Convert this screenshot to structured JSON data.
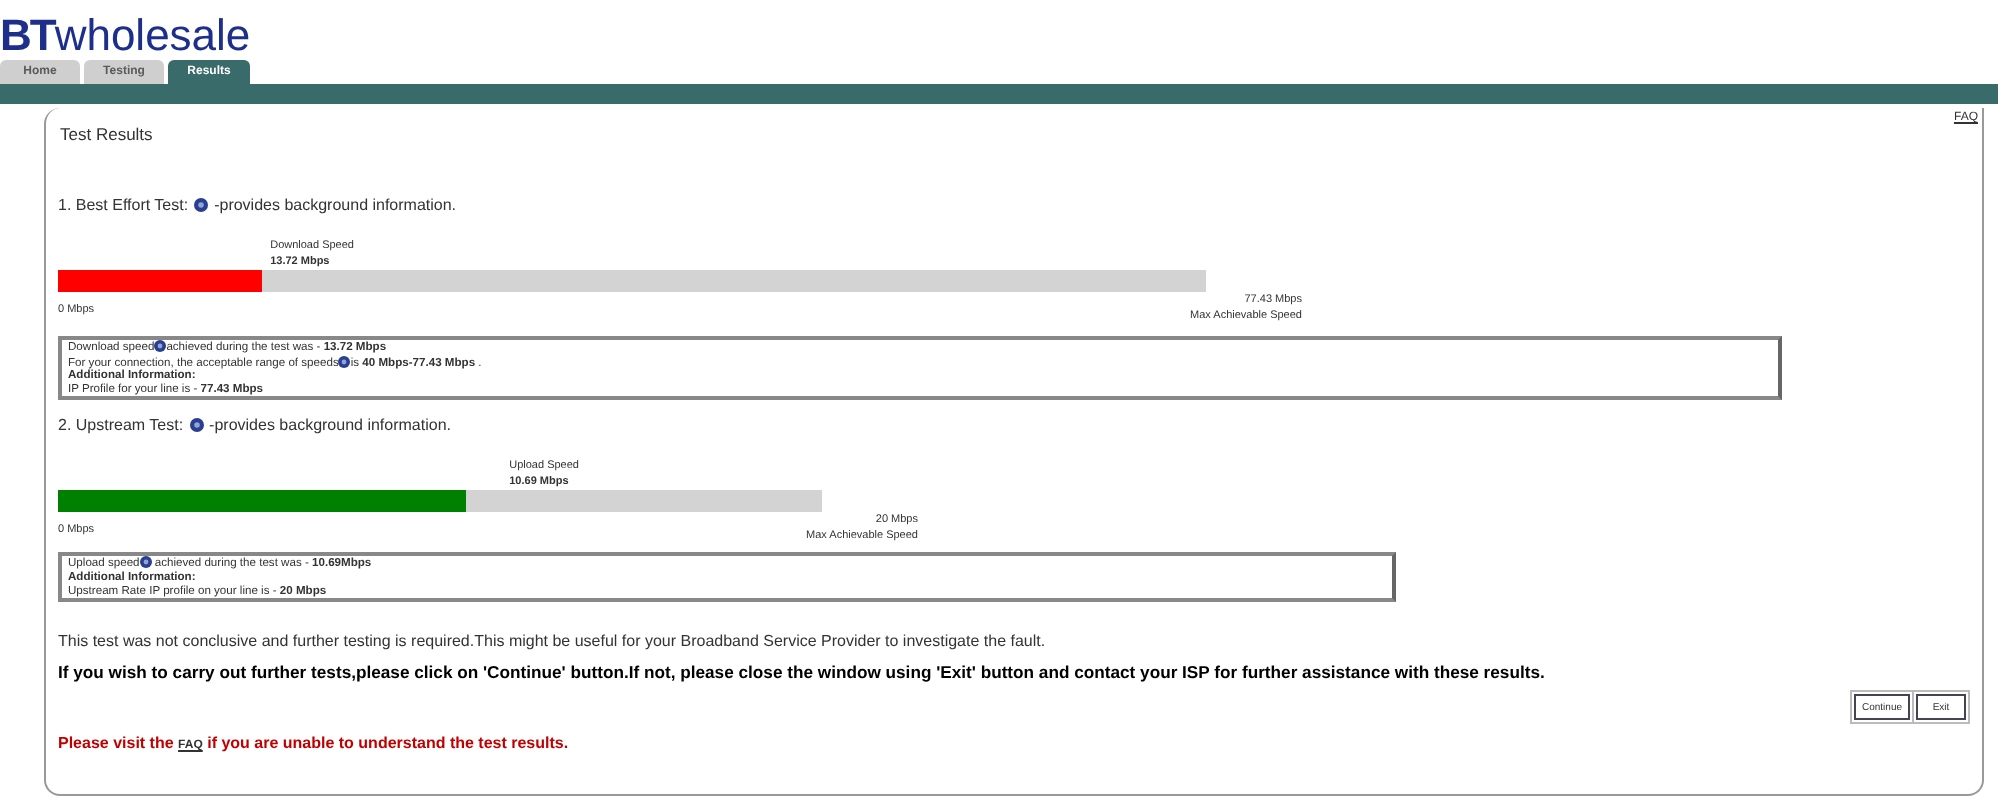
{
  "logo": {
    "brand": "BT",
    "name": "wholesale"
  },
  "tabs": [
    {
      "label": "Home",
      "selected": false
    },
    {
      "label": "Testing",
      "selected": false
    },
    {
      "label": "Results",
      "selected": true
    }
  ],
  "faq_link": "FAQ",
  "title": "Test Results",
  "tests": [
    {
      "heading": "1. Best Effort Test:",
      "note": "-provides background information.",
      "color": "#ff0000",
      "speed_label": "Download Speed",
      "speed": "13.72 Mbps",
      "level": 0.177,
      "min": "0 Mbps",
      "max": "77.43 Mbps",
      "max_label": "Max Achievable Speed",
      "info": [
        {
          "kind": "text",
          "text": "Download speed",
          "after": "achieved during the test was - **13.72 Mbps**"
        },
        {
          "kind": "text",
          "text": "For your connection, the acceptable range of speeds",
          "after": "is **40 Mbps-77.43 Mbps** ."
        },
        {
          "kind": "heading",
          "text": "Additional Information:"
        },
        {
          "kind": "text",
          "text": "IP Profile for your line is - **77.43 Mbps**"
        }
      ]
    },
    {
      "heading": "2. Upstream Test:",
      "note": "-provides background information.",
      "color": "#008000",
      "speed_label": "Upload Speed",
      "speed": "10.69 Mbps",
      "level": 0.534,
      "min": "0 Mbps",
      "max": "20 Mbps",
      "max_label": "Max Achievable Speed",
      "info": [
        {
          "kind": "text",
          "text": "Upload speed",
          "after": " achieved during the test was - **10.69Mbps**"
        },
        {
          "kind": "heading",
          "text": "Additional Information:"
        },
        {
          "kind": "text",
          "text": " Upstream Rate IP profile on your line is - **20 Mbps**"
        }
      ]
    }
  ],
  "conclusion": "This test was not conclusive and further testing is required.This might be useful for your Broadband Service Provider to investigate the fault.",
  "instruction": "If you wish to carry out further tests,please click on 'Continue' button.If not, please close the window using 'Exit' button and contact your ISP for further assistance with these results.",
  "buttons": [
    "Continue",
    "Exit"
  ],
  "help_note": {
    "before": "Please visit the",
    "link": "FAQ",
    "after": "if you are unable to understand the test results."
  }
}
